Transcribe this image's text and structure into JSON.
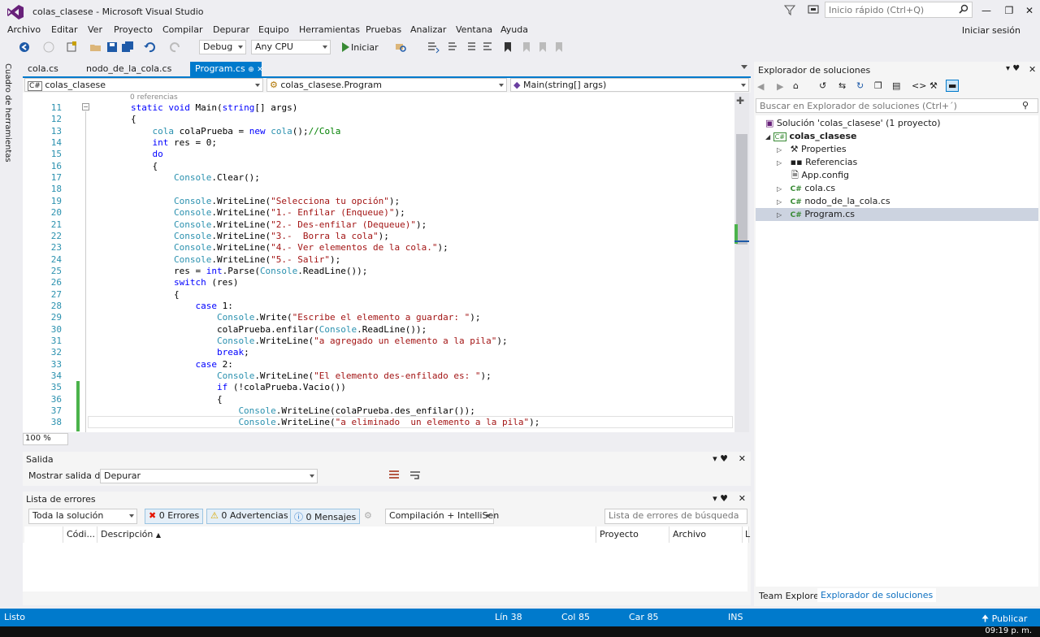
{
  "window": {
    "title": "colas_clasese - Microsoft Visual Studio",
    "quick_launch_placeholder": "Inicio rápido (Ctrl+Q)",
    "sign_in": "Iniciar sesión"
  },
  "menu": [
    "Archivo",
    "Editar",
    "Ver",
    "Proyecto",
    "Compilar",
    "Depurar",
    "Equipo",
    "Herramientas",
    "Pruebas",
    "Analizar",
    "Ventana",
    "Ayuda"
  ],
  "toolbar": {
    "config": "Debug",
    "platform": "Any CPU",
    "start": "Iniciar"
  },
  "toolbox_label": "Cuadro de herramientas",
  "tabs": [
    {
      "label": "cola.cs"
    },
    {
      "label": "nodo_de_la_cola.cs"
    },
    {
      "label": "Program.cs"
    }
  ],
  "nav": {
    "project": "colas_clasese",
    "class": "colas_clasese.Program",
    "member": "Main(string[] args)"
  },
  "refs_hint": "0 referencias",
  "code": [
    {
      "n": "11",
      "t": "        static void Main(string[] args)"
    },
    {
      "n": "12",
      "t": "        {"
    },
    {
      "n": "13",
      "t": "            cola colaPrueba = new cola();//Cola"
    },
    {
      "n": "14",
      "t": "            int res = 0;"
    },
    {
      "n": "15",
      "t": "            do"
    },
    {
      "n": "16",
      "t": "            {"
    },
    {
      "n": "17",
      "t": "                Console.Clear();"
    },
    {
      "n": "18",
      "t": ""
    },
    {
      "n": "19",
      "t": "                Console.WriteLine(\"Selecciona tu opción\");"
    },
    {
      "n": "20",
      "t": "                Console.WriteLine(\"1.- Enfilar (Enqueue)\");"
    },
    {
      "n": "21",
      "t": "                Console.WriteLine(\"2.- Des-enfilar (Dequeue)\");"
    },
    {
      "n": "22",
      "t": "                Console.WriteLine(\"3.-  Borra la cola\");"
    },
    {
      "n": "23",
      "t": "                Console.WriteLine(\"4.- Ver elementos de la cola.\");"
    },
    {
      "n": "24",
      "t": "                Console.WriteLine(\"5.- Salir\");"
    },
    {
      "n": "25",
      "t": "                res = int.Parse(Console.ReadLine());"
    },
    {
      "n": "26",
      "t": "                switch (res)"
    },
    {
      "n": "27",
      "t": "                {"
    },
    {
      "n": "28",
      "t": "                    case 1:"
    },
    {
      "n": "29",
      "t": "                        Console.Write(\"Escribe el elemento a guardar: \");"
    },
    {
      "n": "30",
      "t": "                        colaPrueba.enfilar(Console.ReadLine());"
    },
    {
      "n": "31",
      "t": "                        Console.WriteLine(\"a agregado un elemento a la pila\");"
    },
    {
      "n": "32",
      "t": "                        break;"
    },
    {
      "n": "33",
      "t": "                    case 2:"
    },
    {
      "n": "34",
      "t": "                        Console.WriteLine(\"El elemento des-enfilado es: \");"
    },
    {
      "n": "35",
      "t": "                        if (!colaPrueba.Vacio())"
    },
    {
      "n": "36",
      "t": "                        {"
    },
    {
      "n": "37",
      "t": "                            Console.WriteLine(colaPrueba.des_enfilar());"
    },
    {
      "n": "38",
      "t": "                            Console.WriteLine(\"a eliminado  un elemento a la pila\");"
    }
  ],
  "zoom": "100 %",
  "output": {
    "title": "Salida",
    "show_label": "Mostrar salida de:",
    "source": "Depurar"
  },
  "errors": {
    "title": "Lista de errores",
    "scope": "Toda la solución",
    "errors": "0 Errores",
    "warnings": "0 Advertencias",
    "messages": "0 Mensajes",
    "build": "Compilación + IntelliSen",
    "search_placeholder": "Lista de errores de búsqueda",
    "columns": [
      "Códi...",
      "Descripción",
      "Proyecto",
      "Archivo",
      "L"
    ]
  },
  "solution_explorer": {
    "title": "Explorador de soluciones",
    "search_placeholder": "Buscar en Explorador de soluciones (Ctrl+´)",
    "solution": "Solución 'colas_clasese' (1 proyecto)",
    "project": "colas_clasese",
    "items": [
      "Properties",
      "Referencias",
      "App.config",
      "cola.cs",
      "nodo_de_la_cola.cs",
      "Program.cs"
    ],
    "tabs": [
      "Team Explorer",
      "Explorador de soluciones"
    ]
  },
  "status": {
    "state": "Listo",
    "line": "Lín 38",
    "col": "Col 85",
    "car": "Car 85",
    "mode": "INS",
    "publish": "Publicar"
  },
  "clock": "09:19 p. m.",
  "colors": {
    "accent": "#007acc"
  }
}
